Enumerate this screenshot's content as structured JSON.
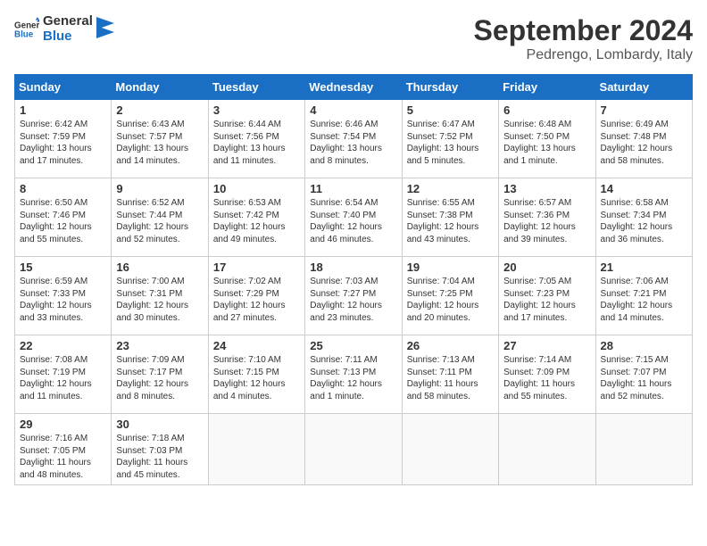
{
  "header": {
    "logo_line1": "General",
    "logo_line2": "Blue",
    "month": "September 2024",
    "location": "Pedrengo, Lombardy, Italy"
  },
  "days_of_week": [
    "Sunday",
    "Monday",
    "Tuesday",
    "Wednesday",
    "Thursday",
    "Friday",
    "Saturday"
  ],
  "weeks": [
    [
      {
        "day": "1",
        "lines": [
          "Sunrise: 6:42 AM",
          "Sunset: 7:59 PM",
          "Daylight: 13 hours",
          "and 17 minutes."
        ]
      },
      {
        "day": "2",
        "lines": [
          "Sunrise: 6:43 AM",
          "Sunset: 7:57 PM",
          "Daylight: 13 hours",
          "and 14 minutes."
        ]
      },
      {
        "day": "3",
        "lines": [
          "Sunrise: 6:44 AM",
          "Sunset: 7:56 PM",
          "Daylight: 13 hours",
          "and 11 minutes."
        ]
      },
      {
        "day": "4",
        "lines": [
          "Sunrise: 6:46 AM",
          "Sunset: 7:54 PM",
          "Daylight: 13 hours",
          "and 8 minutes."
        ]
      },
      {
        "day": "5",
        "lines": [
          "Sunrise: 6:47 AM",
          "Sunset: 7:52 PM",
          "Daylight: 13 hours",
          "and 5 minutes."
        ]
      },
      {
        "day": "6",
        "lines": [
          "Sunrise: 6:48 AM",
          "Sunset: 7:50 PM",
          "Daylight: 13 hours",
          "and 1 minute."
        ]
      },
      {
        "day": "7",
        "lines": [
          "Sunrise: 6:49 AM",
          "Sunset: 7:48 PM",
          "Daylight: 12 hours",
          "and 58 minutes."
        ]
      }
    ],
    [
      {
        "day": "8",
        "lines": [
          "Sunrise: 6:50 AM",
          "Sunset: 7:46 PM",
          "Daylight: 12 hours",
          "and 55 minutes."
        ]
      },
      {
        "day": "9",
        "lines": [
          "Sunrise: 6:52 AM",
          "Sunset: 7:44 PM",
          "Daylight: 12 hours",
          "and 52 minutes."
        ]
      },
      {
        "day": "10",
        "lines": [
          "Sunrise: 6:53 AM",
          "Sunset: 7:42 PM",
          "Daylight: 12 hours",
          "and 49 minutes."
        ]
      },
      {
        "day": "11",
        "lines": [
          "Sunrise: 6:54 AM",
          "Sunset: 7:40 PM",
          "Daylight: 12 hours",
          "and 46 minutes."
        ]
      },
      {
        "day": "12",
        "lines": [
          "Sunrise: 6:55 AM",
          "Sunset: 7:38 PM",
          "Daylight: 12 hours",
          "and 43 minutes."
        ]
      },
      {
        "day": "13",
        "lines": [
          "Sunrise: 6:57 AM",
          "Sunset: 7:36 PM",
          "Daylight: 12 hours",
          "and 39 minutes."
        ]
      },
      {
        "day": "14",
        "lines": [
          "Sunrise: 6:58 AM",
          "Sunset: 7:34 PM",
          "Daylight: 12 hours",
          "and 36 minutes."
        ]
      }
    ],
    [
      {
        "day": "15",
        "lines": [
          "Sunrise: 6:59 AM",
          "Sunset: 7:33 PM",
          "Daylight: 12 hours",
          "and 33 minutes."
        ]
      },
      {
        "day": "16",
        "lines": [
          "Sunrise: 7:00 AM",
          "Sunset: 7:31 PM",
          "Daylight: 12 hours",
          "and 30 minutes."
        ]
      },
      {
        "day": "17",
        "lines": [
          "Sunrise: 7:02 AM",
          "Sunset: 7:29 PM",
          "Daylight: 12 hours",
          "and 27 minutes."
        ]
      },
      {
        "day": "18",
        "lines": [
          "Sunrise: 7:03 AM",
          "Sunset: 7:27 PM",
          "Daylight: 12 hours",
          "and 23 minutes."
        ]
      },
      {
        "day": "19",
        "lines": [
          "Sunrise: 7:04 AM",
          "Sunset: 7:25 PM",
          "Daylight: 12 hours",
          "and 20 minutes."
        ]
      },
      {
        "day": "20",
        "lines": [
          "Sunrise: 7:05 AM",
          "Sunset: 7:23 PM",
          "Daylight: 12 hours",
          "and 17 minutes."
        ]
      },
      {
        "day": "21",
        "lines": [
          "Sunrise: 7:06 AM",
          "Sunset: 7:21 PM",
          "Daylight: 12 hours",
          "and 14 minutes."
        ]
      }
    ],
    [
      {
        "day": "22",
        "lines": [
          "Sunrise: 7:08 AM",
          "Sunset: 7:19 PM",
          "Daylight: 12 hours",
          "and 11 minutes."
        ]
      },
      {
        "day": "23",
        "lines": [
          "Sunrise: 7:09 AM",
          "Sunset: 7:17 PM",
          "Daylight: 12 hours",
          "and 8 minutes."
        ]
      },
      {
        "day": "24",
        "lines": [
          "Sunrise: 7:10 AM",
          "Sunset: 7:15 PM",
          "Daylight: 12 hours",
          "and 4 minutes."
        ]
      },
      {
        "day": "25",
        "lines": [
          "Sunrise: 7:11 AM",
          "Sunset: 7:13 PM",
          "Daylight: 12 hours",
          "and 1 minute."
        ]
      },
      {
        "day": "26",
        "lines": [
          "Sunrise: 7:13 AM",
          "Sunset: 7:11 PM",
          "Daylight: 11 hours",
          "and 58 minutes."
        ]
      },
      {
        "day": "27",
        "lines": [
          "Sunrise: 7:14 AM",
          "Sunset: 7:09 PM",
          "Daylight: 11 hours",
          "and 55 minutes."
        ]
      },
      {
        "day": "28",
        "lines": [
          "Sunrise: 7:15 AM",
          "Sunset: 7:07 PM",
          "Daylight: 11 hours",
          "and 52 minutes."
        ]
      }
    ],
    [
      {
        "day": "29",
        "lines": [
          "Sunrise: 7:16 AM",
          "Sunset: 7:05 PM",
          "Daylight: 11 hours",
          "and 48 minutes."
        ]
      },
      {
        "day": "30",
        "lines": [
          "Sunrise: 7:18 AM",
          "Sunset: 7:03 PM",
          "Daylight: 11 hours",
          "and 45 minutes."
        ]
      },
      {
        "day": "",
        "lines": []
      },
      {
        "day": "",
        "lines": []
      },
      {
        "day": "",
        "lines": []
      },
      {
        "day": "",
        "lines": []
      },
      {
        "day": "",
        "lines": []
      }
    ]
  ]
}
